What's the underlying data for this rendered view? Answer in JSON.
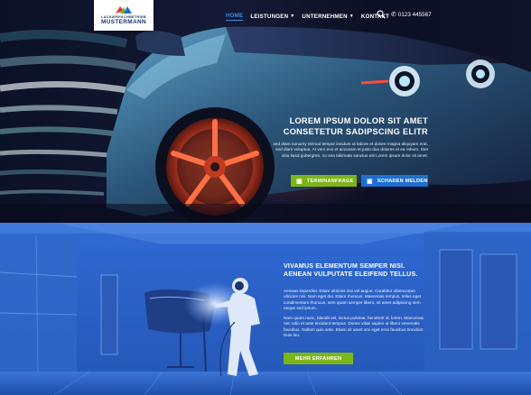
{
  "brand": {
    "subtitle": "LACKIERFACHBETRIEB",
    "name": "MUSTERMANN",
    "colors": {
      "green": "#7cb518",
      "blue": "#1e6fd0",
      "navy": "#1b3a6b"
    }
  },
  "nav": {
    "items": [
      {
        "label": "HOME",
        "dropdown": false
      },
      {
        "label": "LEISTUNGEN",
        "dropdown": true
      },
      {
        "label": "UNTERNEHMEN",
        "dropdown": true
      },
      {
        "label": "KONTAKT",
        "dropdown": false
      }
    ],
    "search_icon": "search-icon",
    "phone_icon": "phone-icon",
    "phone": "0123 445567"
  },
  "hero": {
    "title_line1": "LOREM IPSUM DOLOR SIT AMET",
    "title_line2": "CONSETETUR SADIPSCING ELITR",
    "text": "sed diam nonumy eirmod tempor invidunt ut labore et dolore magna aliquyam erat, sed diam voluptua. At vero eos et accusam et justo duo dolores et ea rebum. Stet clita kasd gubergren, no sea takimata sanctus est Lorem ipsum dolor sit amet.",
    "button_primary": {
      "label": "TERMINANFRAGE",
      "icon": "calendar-icon"
    },
    "button_secondary": {
      "label": "SCHADEN MELDEN",
      "icon": "image-icon"
    }
  },
  "section2": {
    "title_line1": "VIVAMUS ELEMENTUM SEMPER NISI.",
    "title_line2": "AENEAN VULPUTATE ELEIFEND TELLUS.",
    "paragraph1": "Aenean imperdiet. Etiam ultricies nisi vel augue. Curabitur ullamcorper ultricies nisi. Nam eget dui. Etiam rhoncus. Maecenas tempus, tellus eget condimentum rhoncus, sem quam semper libero, sit amet adipiscing sem neque sed ipsum.",
    "paragraph2": "Nam quam nunc, blandit vel, luctus pulvinar, hendrerit id, lorem. Maecenas nec odio et ante tincidunt tempus. Donec vitae sapien ut libero venenatis faucibus. Nullam quis ante. Etiam sit amet orci eget eros faucibus tincidunt. Duis leo.",
    "button": "MEHR ERFAHREN"
  }
}
